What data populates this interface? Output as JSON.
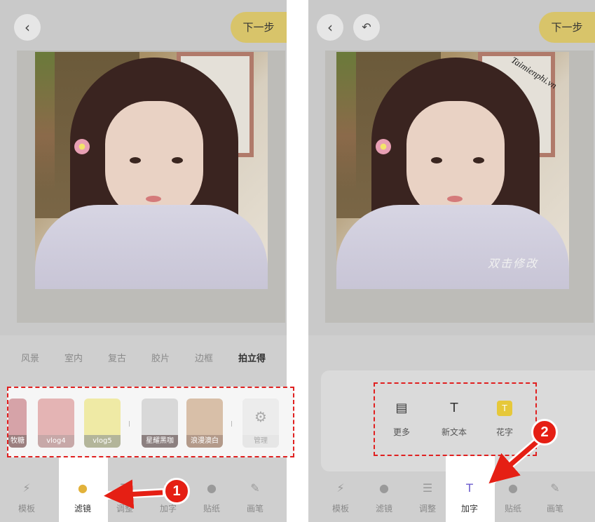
{
  "left": {
    "back_icon": "chevron-left",
    "next_label": "下一步",
    "categories": [
      "风景",
      "室内",
      "复古",
      "胶片",
      "边框",
      "拍立得"
    ],
    "active_category": "拍立得",
    "filters": [
      {
        "label": "牧糖",
        "color": "#d6a3a8"
      },
      {
        "label": "vlog4",
        "color": "#c7a8a8"
      },
      {
        "label": "vlog5",
        "color": "#b3b59a"
      },
      {
        "label": "星耀黑咖",
        "color": "#8c8080"
      },
      {
        "label": "浪漫澳白",
        "color": "#b39a8a"
      },
      {
        "label": "管理",
        "color": "#e6e6e6"
      }
    ],
    "manage_icon": "gear-icon",
    "nav": [
      "模板",
      "滤镜",
      "调整",
      "加字",
      "贴纸",
      "画笔"
    ],
    "active_nav": "滤镜",
    "step": "1"
  },
  "right": {
    "back_icon": "chevron-left",
    "undo_icon": "undo-arrow",
    "next_label": "下一步",
    "overlay_text": "双击修改",
    "watermark": "Taimienphi.vn",
    "tools": [
      {
        "label": "更多",
        "icon": "shop-icon"
      },
      {
        "label": "新文本",
        "icon": "text-add-icon"
      },
      {
        "label": "花字",
        "icon": "fancy-text-icon"
      }
    ],
    "nav": [
      "模板",
      "滤镜",
      "调整",
      "加字",
      "贴纸",
      "画笔"
    ],
    "active_nav": "加字",
    "step": "2"
  },
  "colors": {
    "accent": "#d8c46a",
    "highlight_dash": "#e02020",
    "step_badge": "#e51f14"
  }
}
